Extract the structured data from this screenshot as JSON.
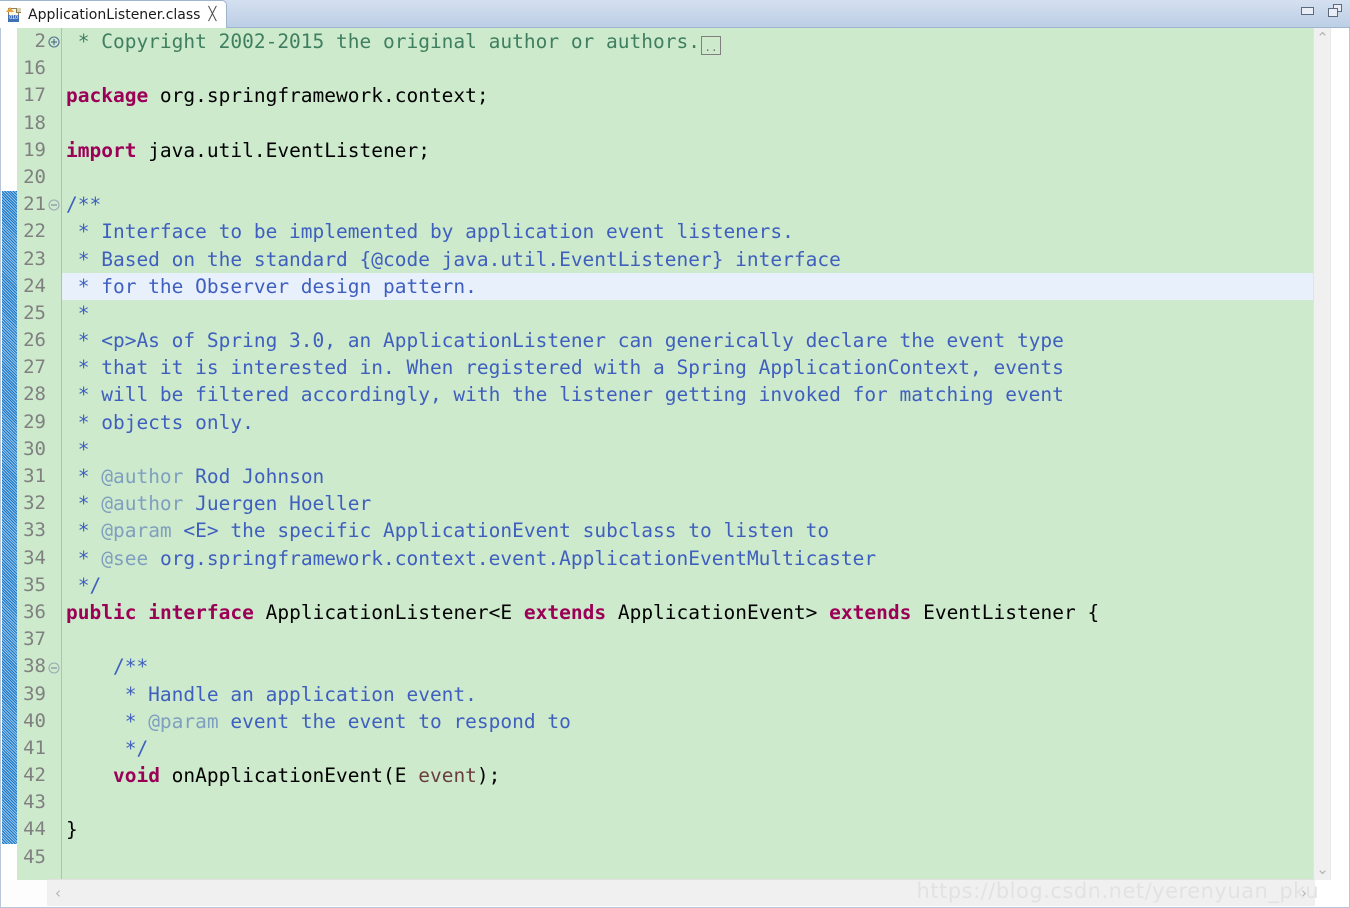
{
  "window": {
    "minimize_label": "Minimize",
    "restore_label": "Restore",
    "minimize_icon": "minimize-icon",
    "restore_icon": "restore-icon"
  },
  "tab": {
    "title": "ApplicationListener.class",
    "close_glyph": "╳",
    "icon_name": "class-file-icon",
    "icon_bits": "010"
  },
  "gutter": {
    "lines": [
      {
        "num": "2",
        "fold": "expand"
      },
      {
        "num": "16",
        "fold": ""
      },
      {
        "num": "17",
        "fold": ""
      },
      {
        "num": "18",
        "fold": ""
      },
      {
        "num": "19",
        "fold": ""
      },
      {
        "num": "20",
        "fold": ""
      },
      {
        "num": "21",
        "fold": "collapse"
      },
      {
        "num": "22",
        "fold": ""
      },
      {
        "num": "23",
        "fold": ""
      },
      {
        "num": "24",
        "fold": ""
      },
      {
        "num": "25",
        "fold": ""
      },
      {
        "num": "26",
        "fold": ""
      },
      {
        "num": "27",
        "fold": ""
      },
      {
        "num": "28",
        "fold": ""
      },
      {
        "num": "29",
        "fold": ""
      },
      {
        "num": "30",
        "fold": ""
      },
      {
        "num": "31",
        "fold": ""
      },
      {
        "num": "32",
        "fold": ""
      },
      {
        "num": "33",
        "fold": ""
      },
      {
        "num": "34",
        "fold": ""
      },
      {
        "num": "35",
        "fold": ""
      },
      {
        "num": "36",
        "fold": ""
      },
      {
        "num": "37",
        "fold": ""
      },
      {
        "num": "38",
        "fold": "collapse"
      },
      {
        "num": "39",
        "fold": ""
      },
      {
        "num": "40",
        "fold": ""
      },
      {
        "num": "41",
        "fold": ""
      },
      {
        "num": "42",
        "fold": ""
      },
      {
        "num": "43",
        "fold": ""
      },
      {
        "num": "44",
        "fold": ""
      },
      {
        "num": "45",
        "fold": ""
      }
    ]
  },
  "code": {
    "current_line_index": 9,
    "folded_box_text": "..",
    "lines": [
      [
        {
          "t": " * Copyright 2002-2015 the original author or authors.",
          "c": "cmt-blk"
        },
        {
          "t": "FOLDBOX",
          "c": "foldbox"
        }
      ],
      [],
      [
        {
          "t": "package",
          "c": "kw"
        },
        {
          "t": " org.springframework.context;",
          "c": "plain"
        }
      ],
      [],
      [
        {
          "t": "import",
          "c": "kw"
        },
        {
          "t": " java.util.EventListener;",
          "c": "plain"
        }
      ],
      [],
      [
        {
          "t": "/**",
          "c": "cmt"
        }
      ],
      [
        {
          "t": " * Interface to be implemented by application event listeners.",
          "c": "cmt"
        }
      ],
      [
        {
          "t": " * Based on the standard {@code java.util.EventListener} interface",
          "c": "cmt"
        }
      ],
      [
        {
          "t": " * for the Observer design pattern.",
          "c": "cmt"
        }
      ],
      [
        {
          "t": " *",
          "c": "cmt"
        }
      ],
      [
        {
          "t": " * <p>As of Spring 3.0, an ApplicationListener can generically declare the event type",
          "c": "cmt"
        }
      ],
      [
        {
          "t": " * that it is interested in. When registered with a Spring ApplicationContext, events",
          "c": "cmt"
        }
      ],
      [
        {
          "t": " * will be filtered accordingly, with the listener getting invoked for matching event",
          "c": "cmt"
        }
      ],
      [
        {
          "t": " * objects only.",
          "c": "cmt"
        }
      ],
      [
        {
          "t": " *",
          "c": "cmt"
        }
      ],
      [
        {
          "t": " * ",
          "c": "cmt"
        },
        {
          "t": "@author",
          "c": "cmt-tag"
        },
        {
          "t": " Rod Johnson",
          "c": "cmt"
        }
      ],
      [
        {
          "t": " * ",
          "c": "cmt"
        },
        {
          "t": "@author",
          "c": "cmt-tag"
        },
        {
          "t": " Juergen Hoeller",
          "c": "cmt"
        }
      ],
      [
        {
          "t": " * ",
          "c": "cmt"
        },
        {
          "t": "@param",
          "c": "cmt-tag"
        },
        {
          "t": " <E> the specific ApplicationEvent subclass to listen to",
          "c": "cmt"
        }
      ],
      [
        {
          "t": " * ",
          "c": "cmt"
        },
        {
          "t": "@see",
          "c": "cmt-tag"
        },
        {
          "t": " org.springframework.context.event.ApplicationEventMulticaster",
          "c": "cmt"
        }
      ],
      [
        {
          "t": " */",
          "c": "cmt"
        }
      ],
      [
        {
          "t": "public",
          "c": "kw"
        },
        {
          "t": " ",
          "c": "plain"
        },
        {
          "t": "interface",
          "c": "kw"
        },
        {
          "t": " ApplicationListener<E ",
          "c": "plain"
        },
        {
          "t": "extends",
          "c": "kw"
        },
        {
          "t": " ApplicationEvent> ",
          "c": "plain"
        },
        {
          "t": "extends",
          "c": "kw"
        },
        {
          "t": " EventListener {",
          "c": "plain"
        }
      ],
      [],
      [
        {
          "t": "    /**",
          "c": "cmt"
        }
      ],
      [
        {
          "t": "     * Handle an application event.",
          "c": "cmt"
        }
      ],
      [
        {
          "t": "     * ",
          "c": "cmt"
        },
        {
          "t": "@param",
          "c": "cmt-tag"
        },
        {
          "t": " event the event to respond to",
          "c": "cmt"
        }
      ],
      [
        {
          "t": "     */",
          "c": "cmt"
        }
      ],
      [
        {
          "t": "    ",
          "c": "plain"
        },
        {
          "t": "void",
          "c": "kw"
        },
        {
          "t": " onApplicationEvent(E ",
          "c": "plain"
        },
        {
          "t": "event",
          "c": "param"
        },
        {
          "t": ");",
          "c": "plain"
        }
      ],
      [],
      [
        {
          "t": "}",
          "c": "plain"
        }
      ],
      []
    ]
  },
  "scrollbars": {
    "vertical_up_glyph": "⌃",
    "vertical_down_glyph": "⌄",
    "horizontal_left_glyph": "‹",
    "horizontal_right_glyph": "›"
  },
  "watermark": {
    "text": "https://blog.csdn.net/yerenyuan_pku"
  },
  "colors": {
    "editor_background": "#cdeacd",
    "current_line": "#e8f0fc",
    "keyword": "#9c0056",
    "javadoc": "#3f5fbf",
    "javadoc_tag": "#7f9fbf",
    "block_comment": "#3f7f5f",
    "parameter": "#6a3e3e",
    "change_bar": "#1878c8"
  }
}
